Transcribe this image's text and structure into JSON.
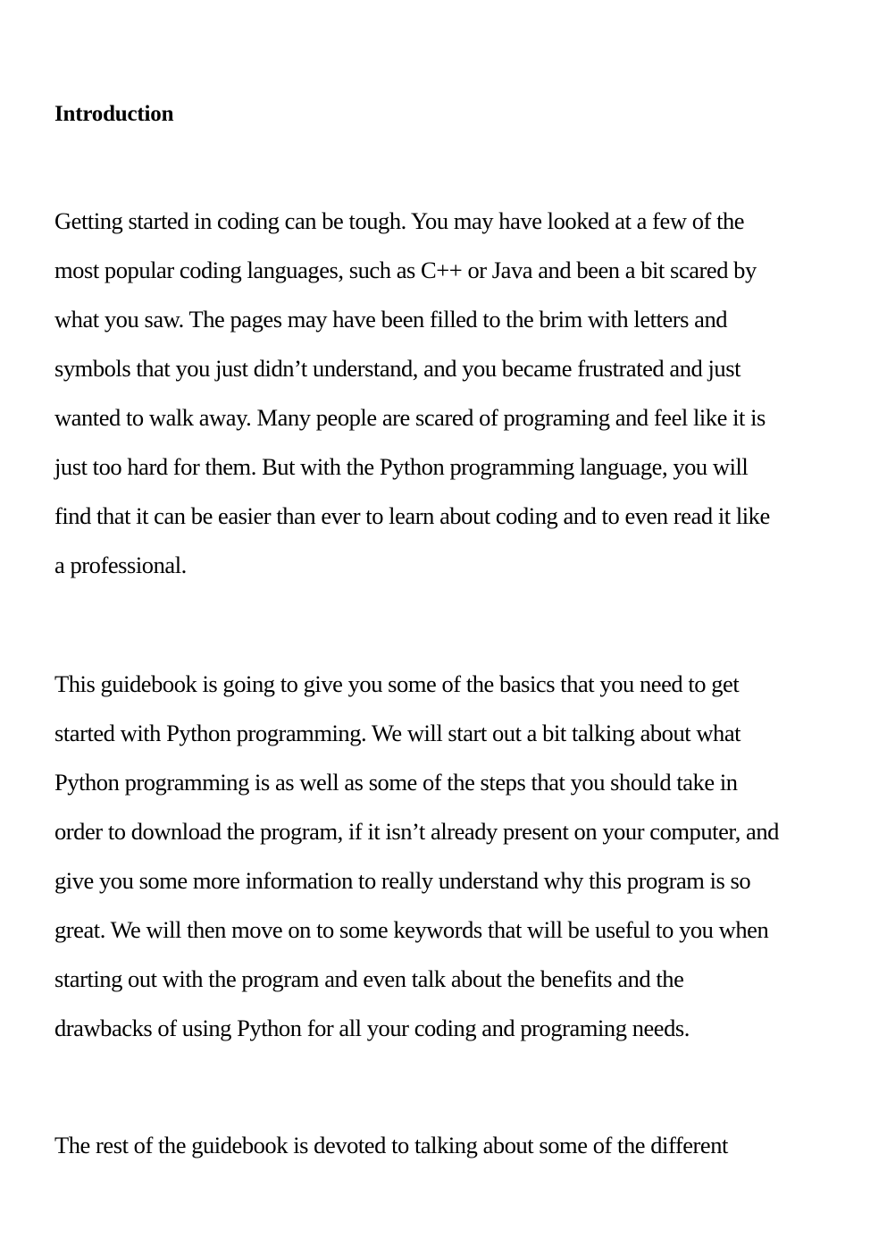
{
  "document": {
    "heading": "Introduction",
    "paragraphs": [
      {
        "lines": [
          "Getting started in coding can be tough. You may have looked at a few of the",
          "most popular coding languages, such as C++ or Java and been a bit scared by",
          "what you saw. The pages may have been filled to the brim with letters and",
          "symbols that you just didn’t understand, and you became frustrated and just",
          "wanted to walk away. Many people are scared of programing and feel like it is",
          "just too hard for them. But with the Python programming language, you will",
          "find that it can be easier than ever to learn about coding and to even read it like",
          "a professional."
        ]
      },
      {
        "lines": [
          "This guidebook is going to give you some of the basics that you need to get",
          "started with Python programming. We will start out a bit talking about what",
          "Python programming is as well as some of the steps that you should take in",
          "order to download the program, if it isn’t already present on your computer, and",
          "give you some more information to really understand why this program is so",
          "great. We will then move on to some keywords that will be useful to you when",
          "starting out with the program and even talk about the benefits and the",
          "drawbacks of using Python for all your coding and programing needs."
        ]
      },
      {
        "lines": [
          "The rest of the guidebook is devoted to talking about some of the different"
        ]
      }
    ]
  }
}
